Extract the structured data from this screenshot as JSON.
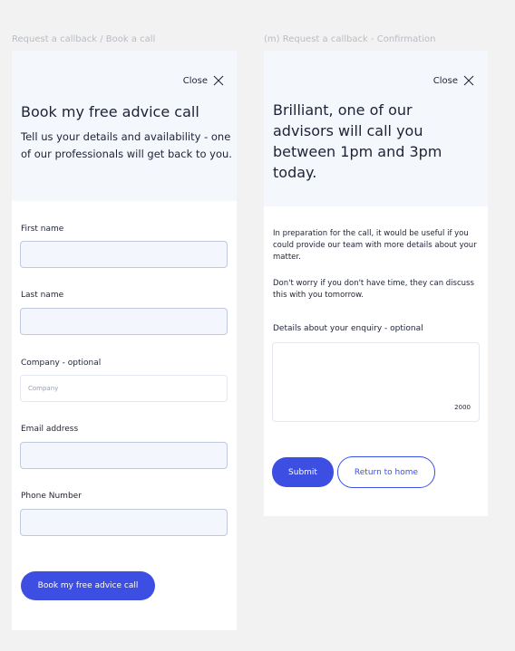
{
  "frames": {
    "left_label": "Request a callback / Book a call",
    "right_label": "(m) Request a callback - Confirmation"
  },
  "booking": {
    "close_label": "Close",
    "title": "Book my free advice call",
    "subtitle": "Tell us your details and availability - one of our professionals will get back to you.",
    "fields": {
      "first_name_label": "First name",
      "last_name_label": "Last name",
      "company_label": "Company - optional",
      "company_placeholder": "Company",
      "email_label": "Email address",
      "phone_label": "Phone Number"
    },
    "submit_label": "Book my free advice call"
  },
  "confirmation": {
    "close_label": "Close",
    "title": "Brilliant, one of our advisors will call you between 1pm and 3pm today.",
    "para1": "In preparation for the call, it would be useful if you could provide our team with more details about your matter.",
    "para2": "Don't worry if you don't have time, they can discuss this with you tomorrow.",
    "details_label": "Details about your enquiry - optional",
    "char_count": "2000",
    "submit_label": "Submit",
    "home_label": "Return to home"
  },
  "icons": {
    "close": "close-x-icon"
  },
  "colors": {
    "accent": "#3d4fe3",
    "header_bg": "#f4f7fc",
    "input_bg": "#f3f6fc",
    "text": "#1e2235",
    "canvas": "#f2f2f2"
  }
}
